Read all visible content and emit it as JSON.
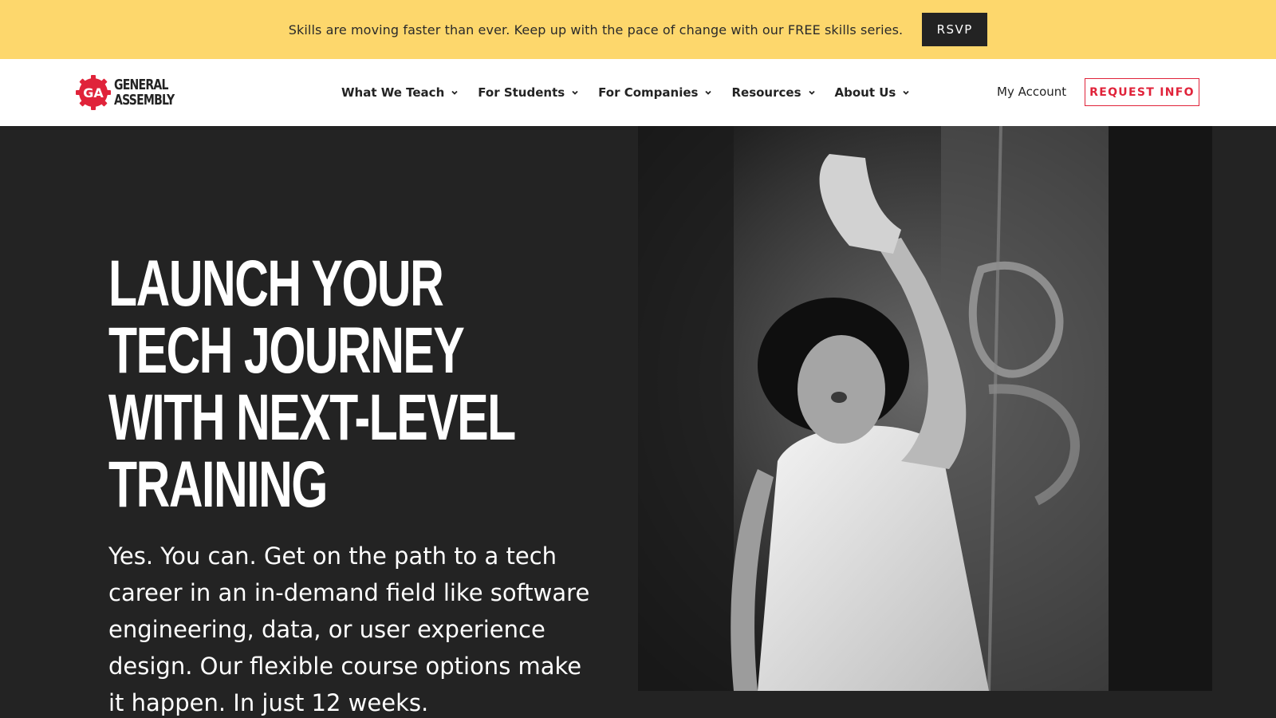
{
  "banner": {
    "text": "Skills are moving faster than ever. Keep up with the pace of change with our FREE skills series.",
    "button_label": "RSVP",
    "background": "#fdd76c"
  },
  "header": {
    "logo": {
      "mark": "GA",
      "line1": "GENERAL",
      "line2": "ASSEMBLY",
      "brand_color": "#e0233a"
    },
    "nav": [
      {
        "label": "What We Teach",
        "icon": "chevron-down-icon"
      },
      {
        "label": "For Students",
        "icon": "chevron-down-icon"
      },
      {
        "label": "For Companies",
        "icon": "chevron-down-icon"
      },
      {
        "label": "Resources",
        "icon": "chevron-down-icon"
      },
      {
        "label": "About Us",
        "icon": "chevron-down-icon"
      }
    ],
    "account_label": "My Account",
    "cta_label": "REQUEST INFO"
  },
  "hero": {
    "heading_lines": [
      "LAUNCH YOUR",
      "TECH JOURNEY",
      "WITH NEXT-LEVEL",
      "TRAINING"
    ],
    "body": "Yes. You can. Get on the path to a tech career in an in-demand field like software engineering, data, or user experience design. Our flexible course options make it happen. In just 12 weeks.",
    "background": "#232323"
  }
}
